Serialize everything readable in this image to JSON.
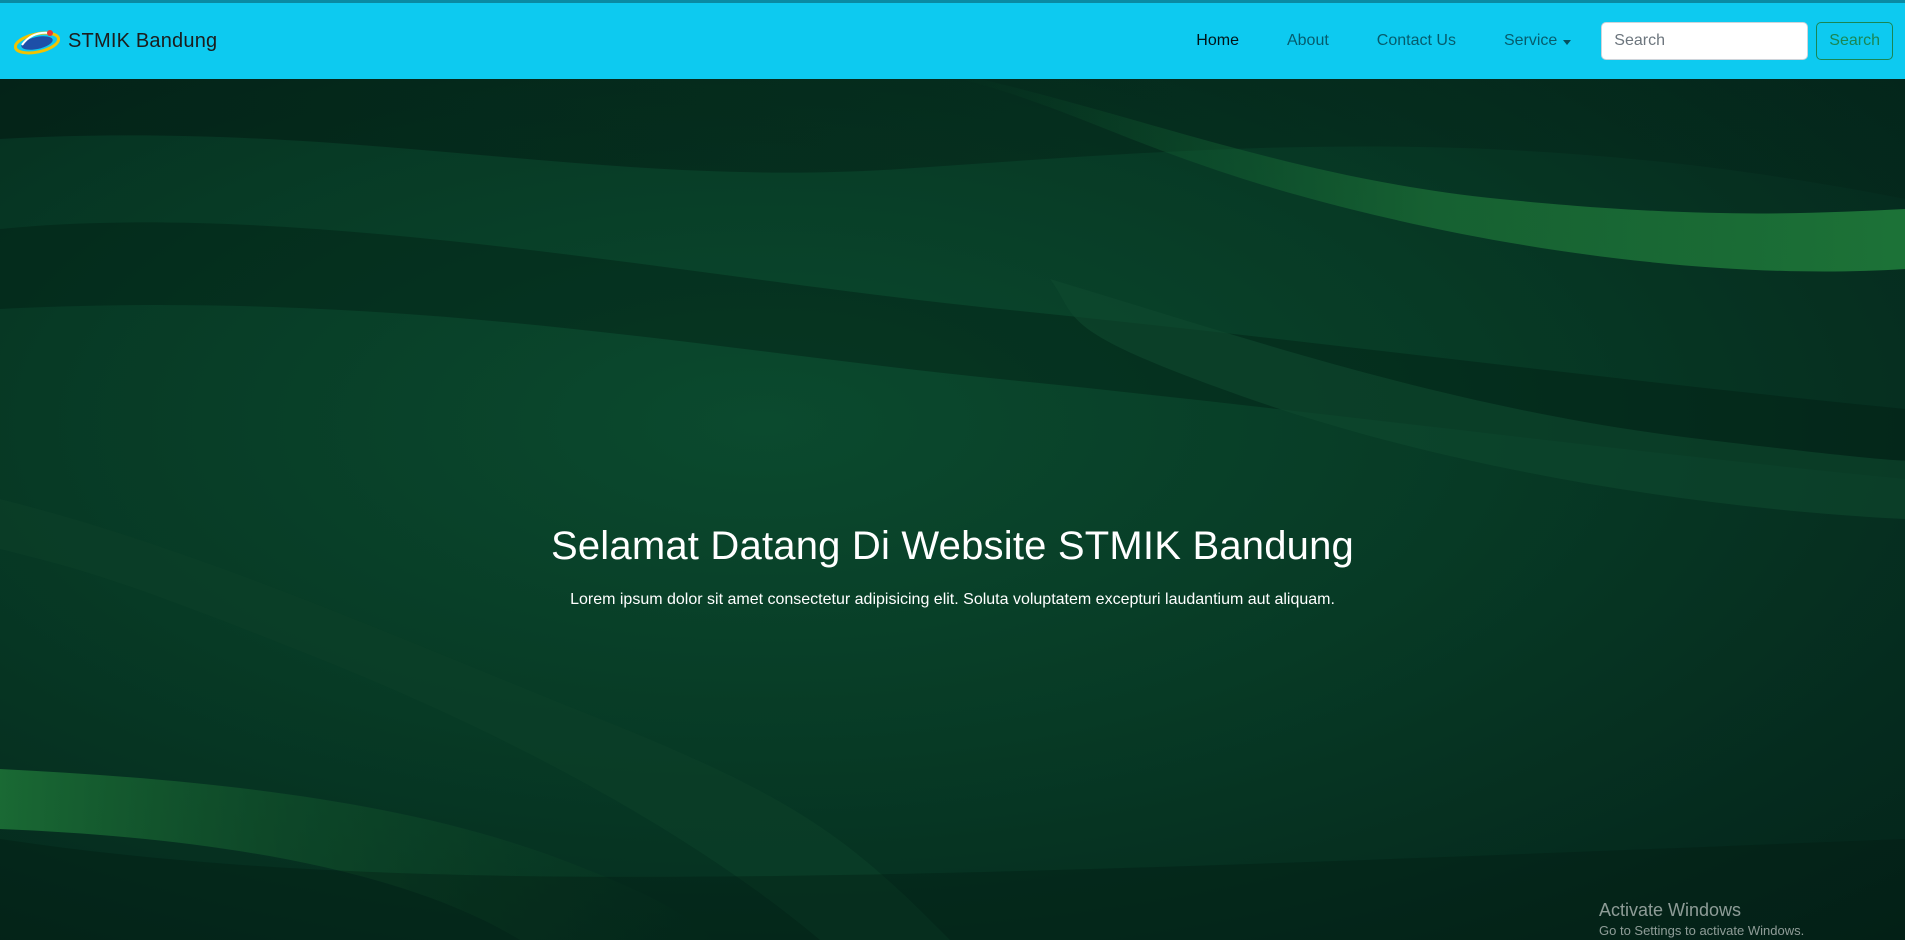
{
  "navbar": {
    "brand_name": "STMIK Bandung",
    "brand_logo_icon": "stmik-logo-icon",
    "background_color": "#0dcaf0",
    "links": [
      {
        "label": "Home",
        "active": true
      },
      {
        "label": "About",
        "active": false
      },
      {
        "label": "Contact Us",
        "active": false
      },
      {
        "label": "Service",
        "active": false,
        "dropdown": true
      }
    ],
    "search": {
      "placeholder": "Search",
      "value": "",
      "button_label": "Search",
      "button_color": "#198754"
    }
  },
  "hero": {
    "title": "Selamat Datang Di Website STMIK Bandung",
    "subtitle": "Lorem ipsum dolor sit amet consectetur adipisicing elit. Soluta voluptatem excepturi laudantium aut aliquam.",
    "background_color": "#073a25"
  },
  "watermark": {
    "title": "Activate Windows",
    "subtitle": "Go to Settings to activate Windows."
  }
}
